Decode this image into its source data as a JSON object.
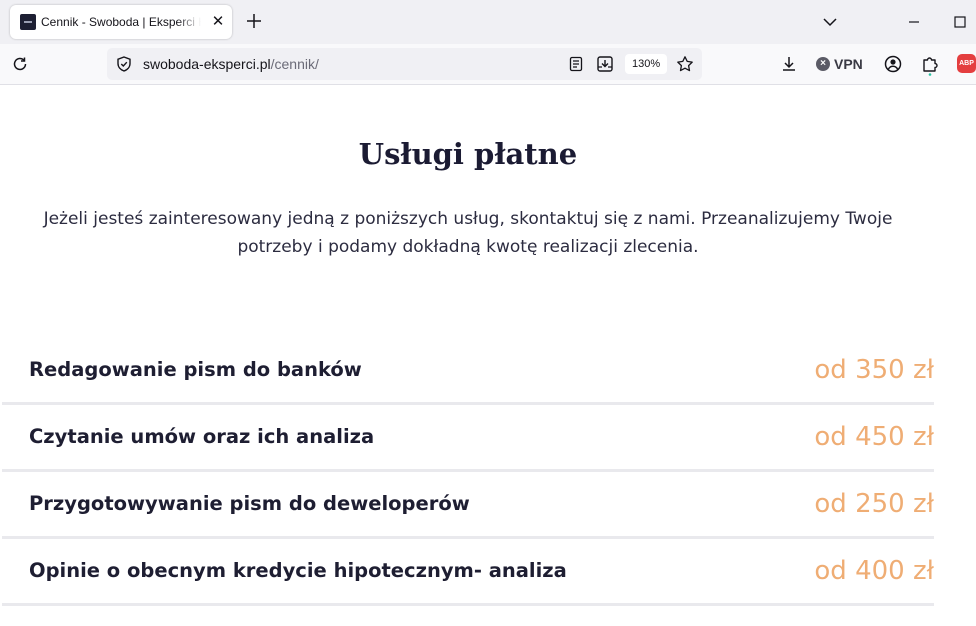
{
  "browser": {
    "tab": {
      "title": "Cennik - Swoboda | Eksperci Hipoteczni",
      "close_glyph": "✕"
    },
    "url": {
      "domain": "swoboda-eksperci.pl",
      "path": "/cennik/"
    },
    "zoom": "130%",
    "vpn_label": "VPN",
    "abp_label": "ABP",
    "icons": {
      "new_tab": "plus-icon",
      "tabs_list": "chevron-down-icon",
      "minimize": "minimize-icon",
      "maximize": "maximize-icon",
      "reload": "reload-icon",
      "security": "shield-icon",
      "reader": "reader-view-icon",
      "save": "save-to-pocket-icon",
      "bookmark": "star-icon",
      "downloads": "download-icon",
      "account": "account-icon",
      "extensions": "puzzle-icon"
    }
  },
  "page": {
    "heading": "Usługi płatne",
    "intro": "Jeżeli jesteś zainteresowany jedną z poniższych usług, skontaktuj się z nami. Przeanalizujemy Twoje potrzeby i podamy dokładną kwotę realizacji zlecenia.",
    "services": [
      {
        "name": "Redagowanie pism do banków",
        "price": "od 350 zł"
      },
      {
        "name": "Czytanie umów oraz ich analiza",
        "price": "od 450 zł"
      },
      {
        "name": "Przygotowywanie pism do deweloperów",
        "price": "od 250 zł"
      },
      {
        "name": "Opinie o obecnym kredycie hipotecznym- analiza",
        "price": "od 400 zł"
      }
    ]
  },
  "colors": {
    "heading": "#1b1b33",
    "text": "#2c2c40",
    "price": "#efad74",
    "divider": "#e9e9ed",
    "abp": "#e43e3f"
  }
}
